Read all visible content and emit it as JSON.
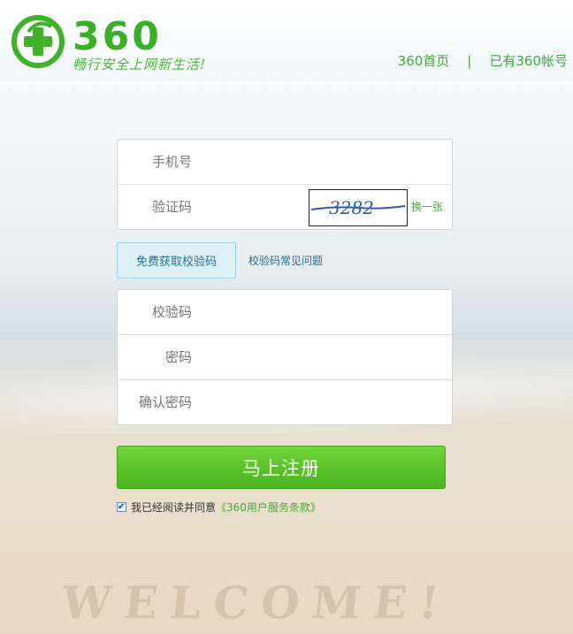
{
  "header": {
    "logo_number": "360",
    "slogan": "畅行安全上网新生活!",
    "nav": {
      "home": "360首页",
      "separator": "|",
      "has_account": "已有360帐号"
    }
  },
  "form": {
    "phone_label": "手机号",
    "captcha_label": "验证码",
    "captcha_text": "3282",
    "captcha_swap": "换一张",
    "sms_button": "免费获取校验码",
    "faq_link": "校验码常见问题",
    "code_label": "校验码",
    "password_label": "密码",
    "confirm_label": "确认密码",
    "submit": "马上注册",
    "agree_text": "我已经阅读并同意",
    "agree_link": "《360用户服务条款》",
    "agree_checked": true
  },
  "background": {
    "watermark": "WELCOME!"
  },
  "colors": {
    "brand_green": "#39b026",
    "button_green": "#5cc32a",
    "link_blue": "#1f6d93"
  }
}
